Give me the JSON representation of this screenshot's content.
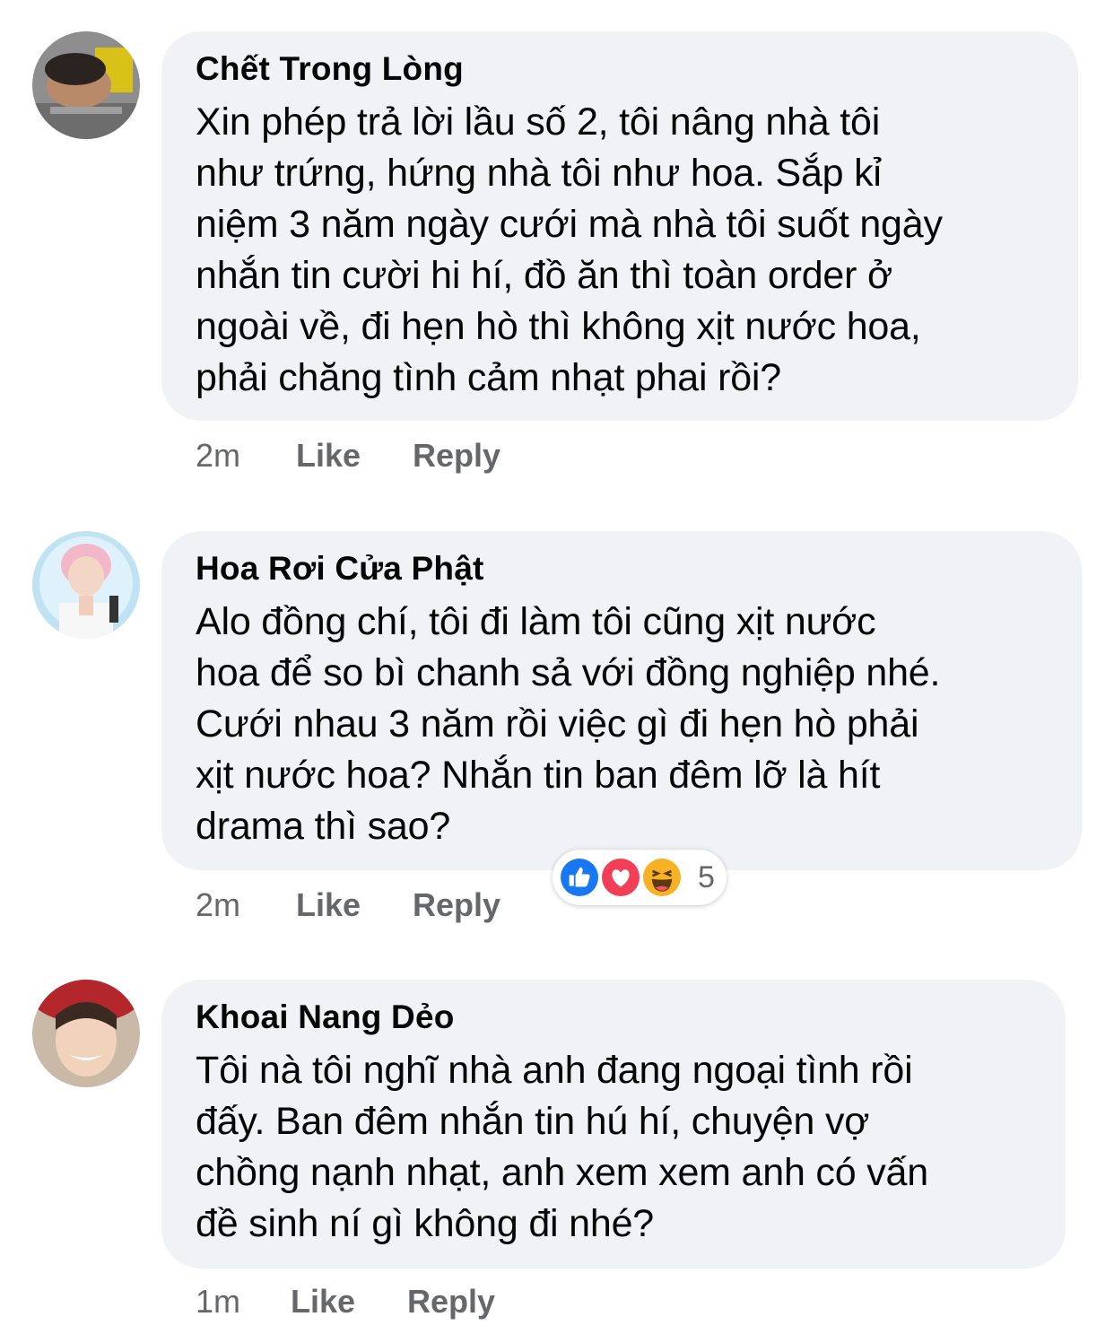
{
  "comments": [
    {
      "author": "Chết Trong Lòng",
      "lines": [
        "Xin phép trả lời lầu số 2, tôi nâng nhà tôi",
        "như trứng, hứng nhà tôi như hoa. Sắp kỉ",
        "niệm 3 năm ngày cưới mà nhà tôi suốt ngày",
        "nhắn tin cười hi hí, đồ ăn thì toàn order ở",
        "ngoài về, đi hẹn hò thì không xịt nước hoa,",
        "phải chăng tình cảm nhạt phai rồi?"
      ],
      "time": "2m",
      "like_label": "Like",
      "reply_label": "Reply"
    },
    {
      "author": "Hoa Rơi Cửa Phật",
      "lines": [
        "Alo đồng chí, tôi đi làm tôi cũng xịt nước",
        "hoa để so bì chanh sả với đồng nghiệp nhé.",
        "Cưới nhau 3 năm rồi việc gì đi hẹn hò phải",
        "xịt nước hoa? Nhắn tin ban đêm lỡ là hít",
        "drama thì sao?"
      ],
      "time": "2m",
      "like_label": "Like",
      "reply_label": "Reply",
      "reactions": {
        "icons": [
          "like-icon",
          "love-icon",
          "haha-icon"
        ],
        "count": "5"
      }
    },
    {
      "author": "Khoai Nang Dẻo",
      "lines": [
        "Tôi nà tôi nghĩ nhà anh đang ngoại tình rồi",
        "đấy. Ban đêm nhắn tin hú hí, chuyện vợ",
        "chồng nạnh nhạt, anh xem xem anh có vấn",
        "đề sinh ní gì không đi nhé?"
      ],
      "time": "1m",
      "like_label": "Like",
      "reply_label": "Reply"
    }
  ],
  "colors": {
    "bubble": "#f0f2f5",
    "text": "#050505",
    "secondary": "#65676b",
    "like_blue": "#1877f2",
    "love_red": "#f33e58",
    "haha_yellow": "#f7b125"
  }
}
